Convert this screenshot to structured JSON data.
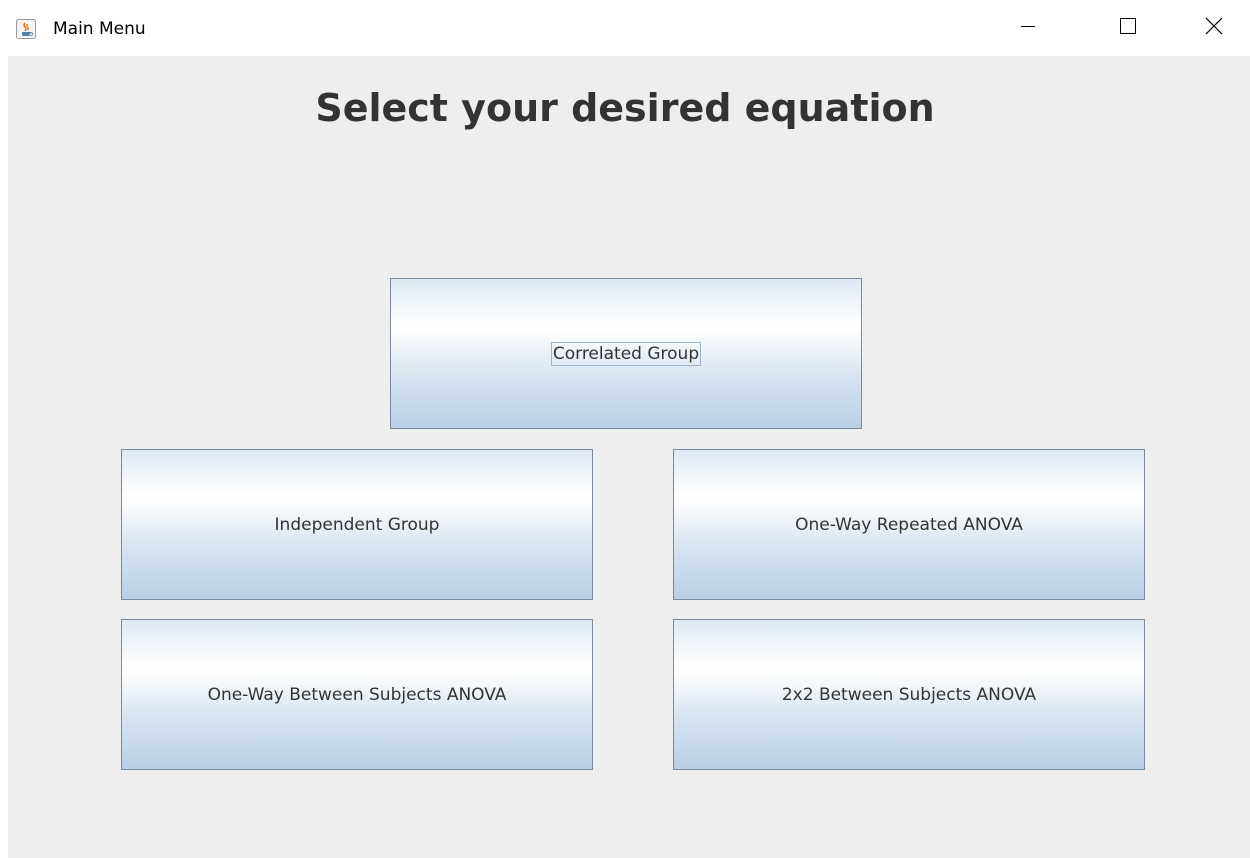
{
  "window": {
    "title": "Main Menu",
    "app_icon": "java-icon",
    "controls": {
      "minimize_icon": "minimize-icon",
      "maximize_icon": "maximize-icon",
      "close_icon": "close-icon"
    }
  },
  "main": {
    "heading": "Select your desired equation",
    "buttons": [
      {
        "label": "Correlated Group",
        "focused": true
      },
      {
        "label": "Independent Group",
        "focused": false
      },
      {
        "label": "One-Way Repeated ANOVA",
        "focused": false
      },
      {
        "label": "One-Way Between Subjects ANOVA",
        "focused": false
      },
      {
        "label": "2x2 Between Subjects ANOVA",
        "focused": false
      }
    ]
  },
  "colors": {
    "content_background": "#eeeeee",
    "heading_text": "#333333",
    "button_border": "#7a8a99",
    "button_gradient_bottom": "#b8cfe5",
    "focus_ring": "#99b4d1"
  }
}
